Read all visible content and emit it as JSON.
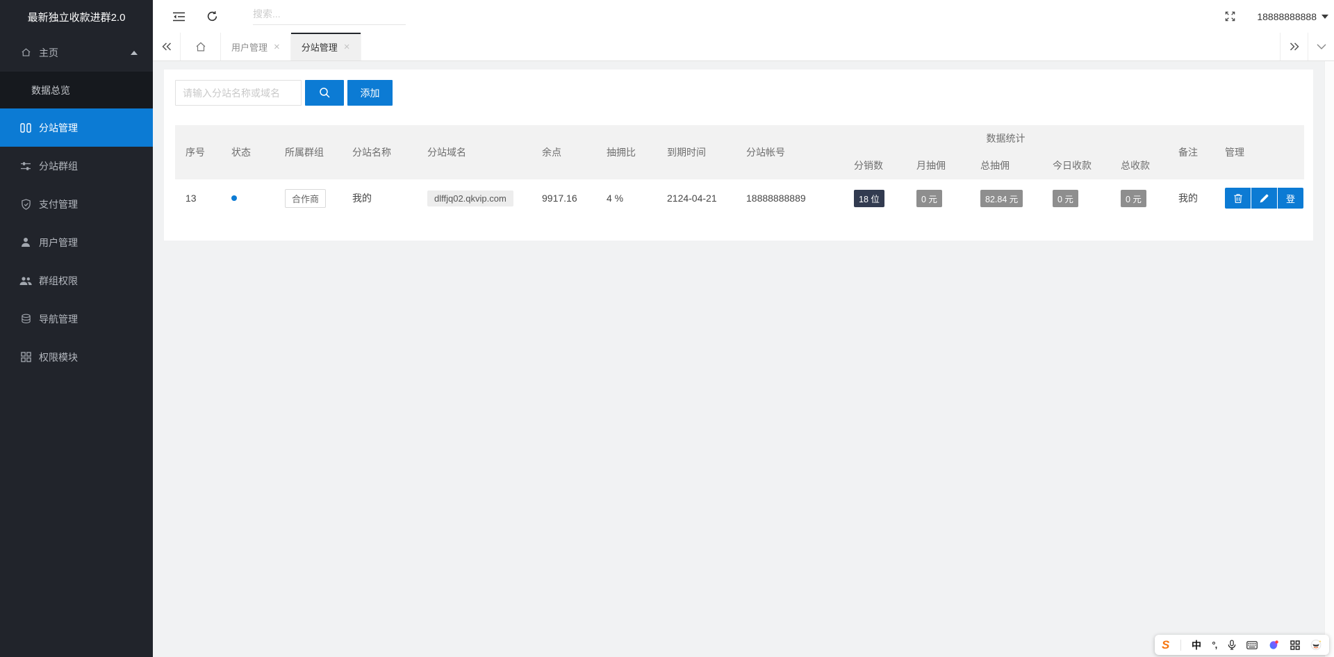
{
  "app": {
    "title": "最新独立收款进群2.0"
  },
  "colors": {
    "accent": "#0c7bd4",
    "badge_dark": "#323b50",
    "badge_gray": "#8e8e8e",
    "sidebar_bg": "#21242b"
  },
  "topbar": {
    "search_placeholder": "搜索...",
    "username": "18888888888"
  },
  "tabs": {
    "items": [
      {
        "label": "用户管理",
        "close": "×",
        "active": false
      },
      {
        "label": "分站管理",
        "close": "×",
        "active": true
      }
    ]
  },
  "sidebar": {
    "items": [
      {
        "label": "主页",
        "icon": "home-icon"
      },
      {
        "label": "数据总览",
        "icon": ""
      },
      {
        "label": "分站管理",
        "icon": "columns-icon"
      },
      {
        "label": "分站群组",
        "icon": "sliders-icon"
      },
      {
        "label": "支付管理",
        "icon": "shield-check-icon"
      },
      {
        "label": "用户管理",
        "icon": "user-icon"
      },
      {
        "label": "群组权限",
        "icon": "users-icon"
      },
      {
        "label": "导航管理",
        "icon": "layers-icon"
      },
      {
        "label": "权限模块",
        "icon": "modules-icon"
      }
    ]
  },
  "panel": {
    "filter_placeholder": "请输入分站名称或域名",
    "add_label": "添加"
  },
  "table": {
    "group_header": "数据统计",
    "headers": [
      "序号",
      "状态",
      "所属群组",
      "分站名称",
      "分站域名",
      "余点",
      "抽拥比",
      "到期时间",
      "分站帐号",
      "分销数",
      "月抽佣",
      "总抽佣",
      "今日收款",
      "总收款",
      "备注",
      "管理"
    ],
    "row": {
      "id": "13",
      "group": "合作商",
      "site_name": "我的",
      "domain": "dlffjq02.qkvip.com",
      "balance": "9917.16",
      "commission_rate": "4 %",
      "expire_date": "2124-04-21",
      "account": "18888888889",
      "distributors": "18 位",
      "month_commission": "0 元",
      "total_commission": "82.84 元",
      "today_income": "0 元",
      "total_income": "0 元",
      "remark": "我的"
    },
    "actions": {
      "login_label": "登"
    }
  },
  "ime": {
    "brand": "S",
    "mode": "中",
    "punct": "°,"
  }
}
